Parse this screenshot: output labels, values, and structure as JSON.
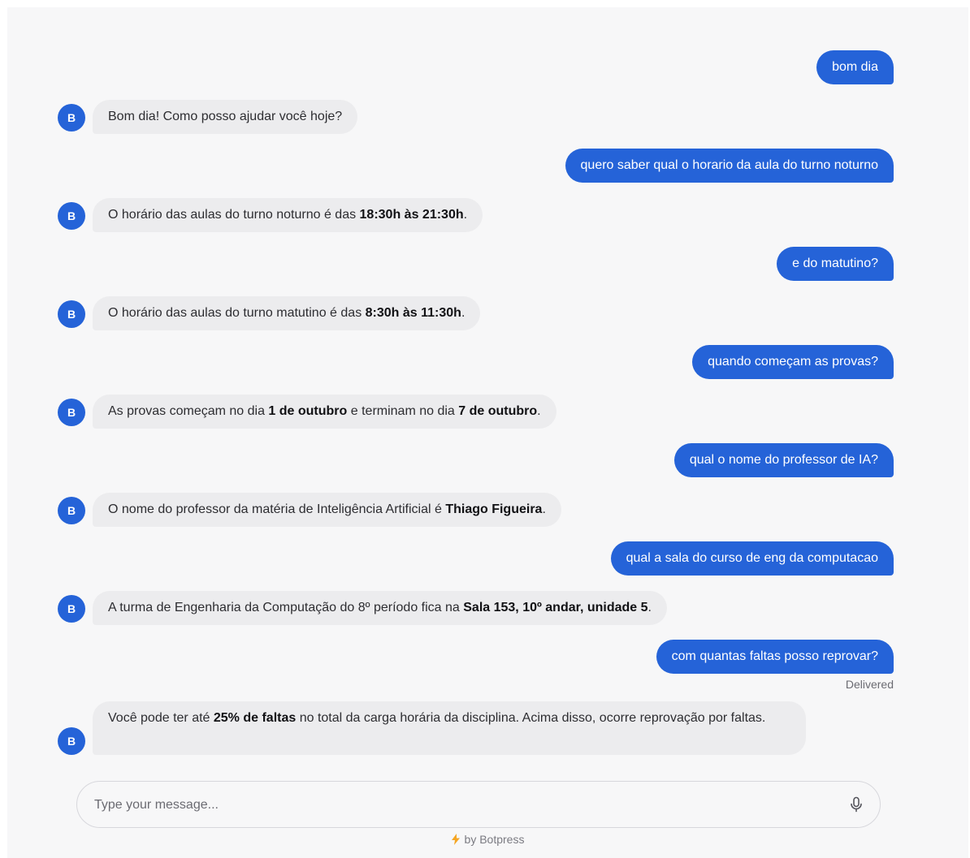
{
  "messages": [
    {
      "role": "user",
      "text": "bom dia"
    },
    {
      "role": "bot",
      "avatar": "B",
      "parts": [
        {
          "t": "Bom dia! Como posso ajudar você hoje?"
        }
      ]
    },
    {
      "role": "user",
      "text": "quero saber qual o horario da aula do turno noturno"
    },
    {
      "role": "bot",
      "avatar": "B",
      "parts": [
        {
          "t": "O horário das aulas do turno noturno é das "
        },
        {
          "t": "18:30h às 21:30h",
          "b": true
        },
        {
          "t": "."
        }
      ]
    },
    {
      "role": "user",
      "text": "e do matutino?"
    },
    {
      "role": "bot",
      "avatar": "B",
      "parts": [
        {
          "t": "O horário das aulas do turno matutino é das "
        },
        {
          "t": "8:30h às 11:30h",
          "b": true
        },
        {
          "t": "."
        }
      ]
    },
    {
      "role": "user",
      "text": "quando começam as provas?"
    },
    {
      "role": "bot",
      "avatar": "B",
      "parts": [
        {
          "t": "As provas começam no dia "
        },
        {
          "t": "1 de outubro",
          "b": true
        },
        {
          "t": " e terminam no dia "
        },
        {
          "t": "7 de outubro",
          "b": true
        },
        {
          "t": "."
        }
      ]
    },
    {
      "role": "user",
      "text": "qual o nome do professor de IA?"
    },
    {
      "role": "bot",
      "avatar": "B",
      "parts": [
        {
          "t": "O nome do professor da matéria de Inteligência Artificial é "
        },
        {
          "t": "Thiago Figueira",
          "b": true
        },
        {
          "t": "."
        }
      ]
    },
    {
      "role": "user",
      "text": "qual a sala do curso de eng da computacao"
    },
    {
      "role": "bot",
      "avatar": "B",
      "parts": [
        {
          "t": "A turma de Engenharia da Computação do 8º período fica na "
        },
        {
          "t": "Sala 153, 10º andar, unidade 5",
          "b": true
        },
        {
          "t": "."
        }
      ]
    },
    {
      "role": "user",
      "text": "com quantas faltas posso reprovar?"
    },
    {
      "role": "bot",
      "avatar": "B",
      "parts": [
        {
          "t": "Você pode ter até "
        },
        {
          "t": "25% de faltas",
          "b": true
        },
        {
          "t": " no total da carga horária da disciplina. Acima disso, ocorre reprovação por faltas."
        }
      ]
    }
  ],
  "status": "Delivered",
  "composer": {
    "placeholder": "Type your message..."
  },
  "footer": {
    "text": "by Botpress"
  },
  "colors": {
    "accent": "#2563d8",
    "bot_bubble": "#ececee",
    "background": "#f7f7f8",
    "bolt": "#f5a623"
  },
  "icons": {
    "mic": "microphone-icon",
    "bolt": "lightning-bolt-icon"
  }
}
